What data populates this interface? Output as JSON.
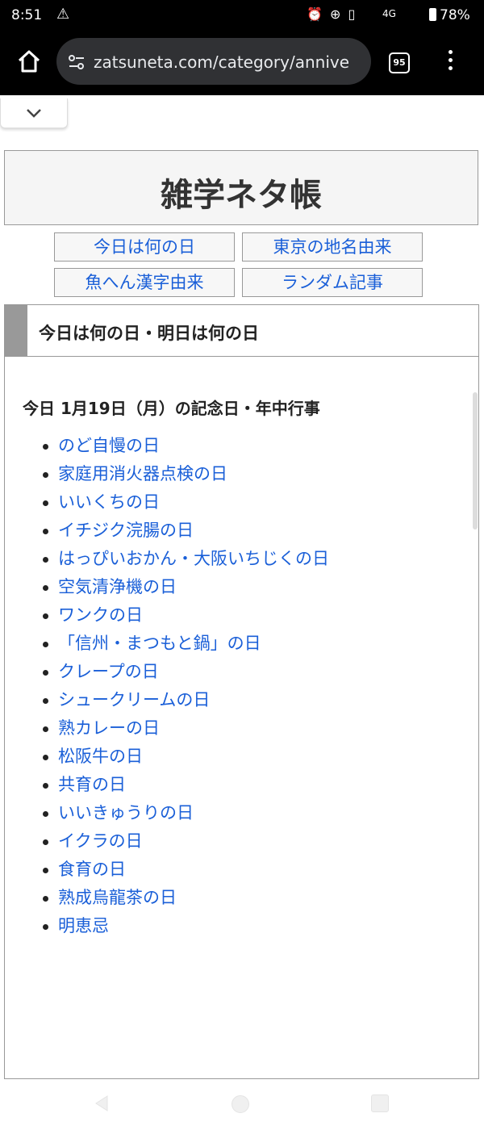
{
  "status_bar": {
    "time": "8:51",
    "network": "4G",
    "battery": "78%"
  },
  "browser": {
    "url": "zatsuneta.com/category/annive",
    "tab_count": "95"
  },
  "site": {
    "title": "雑学ネタ帳",
    "nav": [
      {
        "label": "今日は何の日"
      },
      {
        "label": "東京の地名由来"
      },
      {
        "label": "魚へん漢字由来"
      },
      {
        "label": "ランダム記事"
      }
    ]
  },
  "section": {
    "title": "今日は何の日・明日は何の日",
    "date_heading": "今日 1月19日（月）の記念日・年中行事",
    "events": [
      "のど自慢の日",
      "家庭用消火器点検の日",
      "いいくちの日",
      "イチジク浣腸の日",
      "はっぴいおかん・大阪いちじくの日",
      "空気清浄機の日",
      "ワンクの日",
      "「信州・まつもと鍋」の日",
      "クレープの日",
      "シュークリームの日",
      "熟カレーの日",
      "松阪牛の日",
      "共育の日",
      "いいきゅうりの日",
      "イクラの日",
      "食育の日",
      "熟成烏龍茶の日",
      "明恵忌"
    ]
  },
  "colors": {
    "link": "#1a5fd8",
    "status_bar_bg": "#000000",
    "url_box_bg": "#303134"
  }
}
